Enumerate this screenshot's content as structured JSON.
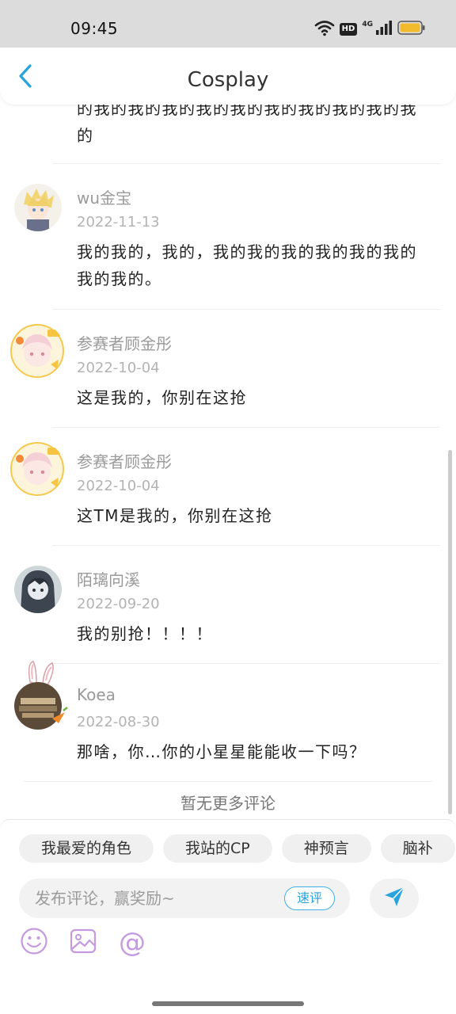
{
  "status_bar": {
    "time": "09:45",
    "hd": "HD",
    "network": "4G",
    "battery_color": "#f2bb2e"
  },
  "header": {
    "title": "Cosplay",
    "back_color": "#2aa3dd"
  },
  "first_comment_tail": "的我的我的我的我的我的我的我的我的我的我的",
  "comments": [
    {
      "author": "wu金宝",
      "date": "2022-11-13",
      "text": "我的我的，我的，我的我的我的我的我的我的我的我的。"
    },
    {
      "author": "参赛者顾金彤",
      "date": "2022-10-04",
      "text": "这是我的，你别在这抢"
    },
    {
      "author": "参赛者顾金彤",
      "date": "2022-10-04",
      "text": "这TM是我的，你别在这抢"
    },
    {
      "author": "陌璃向溪",
      "date": "2022-09-20",
      "text": "我的别抢！！！！"
    },
    {
      "author": "Koea",
      "date": "2022-08-30",
      "text": "那啥，你…你的小星星能能收一下吗？"
    }
  ],
  "footer_note": "暂无更多评论",
  "chips": [
    "我最爱的角色",
    "我站的CP",
    "神预言",
    "脑补"
  ],
  "composer": {
    "placeholder": "发布评论，赢奖励~",
    "quick_label": "速评"
  },
  "icons": [
    "chevron-left-icon",
    "wifi-icon",
    "signal-icon",
    "battery-icon",
    "send-icon",
    "emoji-icon",
    "image-icon",
    "at-icon"
  ]
}
